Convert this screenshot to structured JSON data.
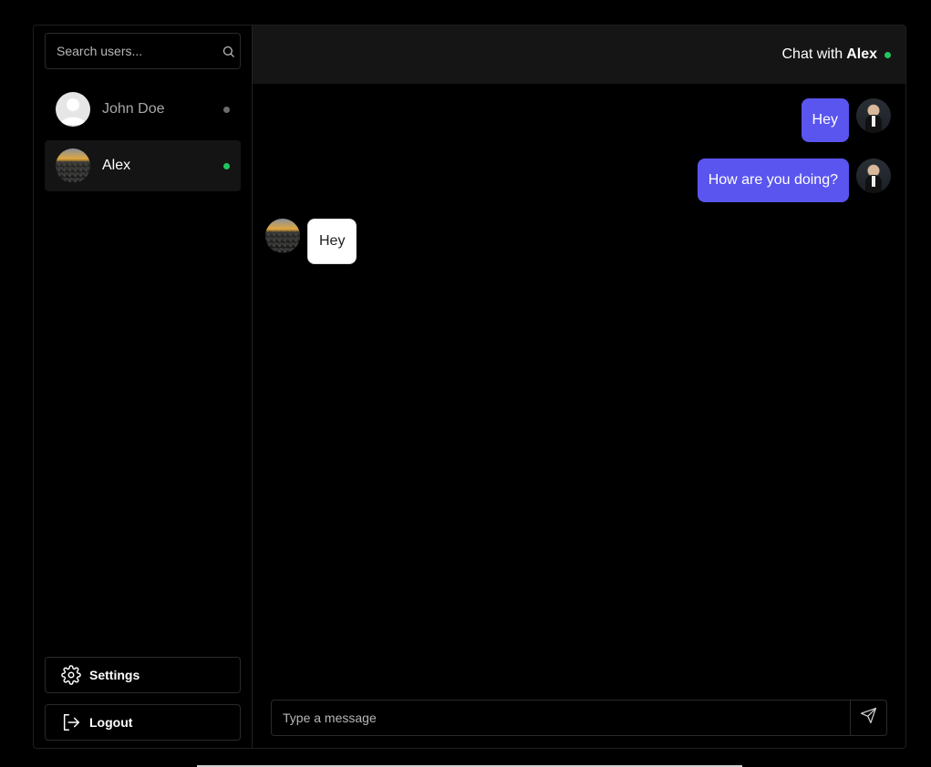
{
  "search": {
    "placeholder": "Search users..."
  },
  "users": [
    {
      "name": "John Doe",
      "status": "offline",
      "status_color": "#6b6b6b",
      "avatar": "default-avatar"
    },
    {
      "name": "Alex",
      "status": "online",
      "status_color": "#22c55e",
      "avatar": "landscape-photo",
      "active": true
    }
  ],
  "sidebar_actions": {
    "settings_label": "Settings",
    "settings_icon": "gear-icon",
    "logout_label": "Logout",
    "logout_icon": "logout-icon"
  },
  "chat_header": {
    "prefix": "Chat with",
    "name": "Alex",
    "status": "online",
    "status_color": "#22c55e"
  },
  "messages": [
    {
      "direction": "outgoing",
      "text": "Hey"
    },
    {
      "direction": "outgoing",
      "text": "How are you doing?"
    },
    {
      "direction": "incoming",
      "text": "Hey"
    }
  ],
  "composer": {
    "placeholder": "Type a message",
    "send_icon": "send-icon"
  },
  "colors": {
    "outgoing_bubble": "#5a55ef",
    "incoming_bubble": "#ffffff",
    "online": "#22c55e",
    "offline": "#6b6b6b"
  }
}
